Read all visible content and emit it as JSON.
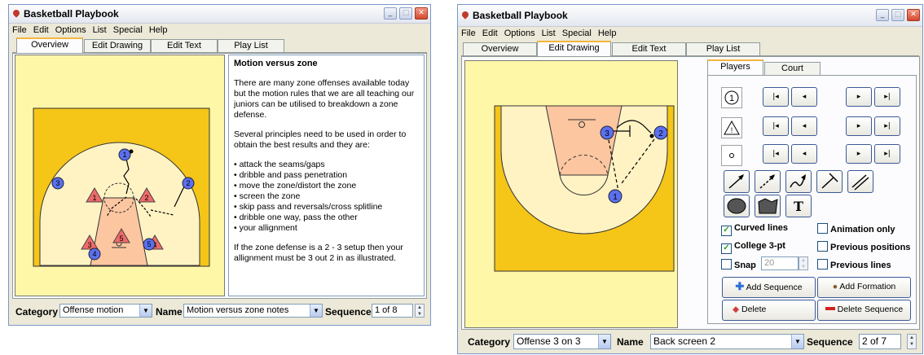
{
  "left_window": {
    "title": "Basketball Playbook",
    "menus": [
      "File",
      "Edit",
      "Options",
      "List",
      "Special",
      "Help"
    ],
    "tabs": [
      "Overview",
      "Edit Drawing",
      "Edit Text",
      "Play List"
    ],
    "active_tab": "Overview",
    "notes": {
      "heading": "Motion versus zone",
      "p1": "There are many zone offenses available today but the motion rules that we are all teaching our juniors can be utilised to breakdown a zone defense.",
      "p2": "Several principles need to be used in order to obtain the best results and they are:",
      "bullets": [
        "attack the seams/gaps",
        "dribble and pass penetration",
        "move the zone/distort the zone",
        "screen the zone",
        "skip pass and reversals/cross splitline",
        "dribble one way, pass the other",
        "your allignment"
      ],
      "p3": "If the zone defense is a 2 - 3 setup then your allignment must be 3 out 2 in as illustrated."
    },
    "court_players": [
      "1",
      "2",
      "3",
      "4",
      "5"
    ],
    "court_defenders": [
      "1",
      "2",
      "3",
      "4",
      "5"
    ],
    "category_label": "Category",
    "category_value": "Offense motion",
    "name_label": "Name",
    "name_value": "Motion versus zone notes",
    "sequence_label": "Sequence",
    "sequence_value": "1 of 8"
  },
  "right_window": {
    "title": "Basketball Playbook",
    "menus": [
      "File",
      "Edit",
      "Options",
      "List",
      "Special",
      "Help"
    ],
    "tabs": [
      "Overview",
      "Edit Drawing",
      "Edit Text",
      "Play List"
    ],
    "active_tab": "Edit Drawing",
    "subtabs": [
      "Players",
      "Court"
    ],
    "court_players": [
      "3",
      "2",
      "1"
    ],
    "symbol_player": "1",
    "nav_glyphs": [
      "|◂",
      "◂",
      "▸",
      "▸|"
    ],
    "checkboxes": {
      "curved_lines": {
        "label": "Curved lines",
        "checked": true
      },
      "animation_only": {
        "label": "Animation only",
        "checked": false
      },
      "college_3pt": {
        "label": "College 3-pt",
        "checked": true
      },
      "previous_positions": {
        "label": "Previous positions",
        "checked": false
      },
      "snap": {
        "label": "Snap",
        "checked": false
      },
      "snap_value": "20",
      "previous_lines": {
        "label": "Previous lines",
        "checked": false
      }
    },
    "buttons": {
      "add_sequence": "Add Sequence",
      "add_formation": "Add Formation",
      "delete": "Delete",
      "delete_sequence": "Delete Sequence"
    },
    "category_label": "Category",
    "category_value": "Offense 3 on 3",
    "name_label": "Name",
    "name_value": "Back screen 2",
    "sequence_label": "Sequence",
    "sequence_value": "2 of 7"
  },
  "colors": {
    "court_bg": "#fff7a8",
    "court_boundary": "#f5c518",
    "arc_fill": "#fff3c4",
    "lane_fill": "#fcc6a0",
    "player_fill": "#5a70f0",
    "defender_fill": "#f06a6a"
  }
}
